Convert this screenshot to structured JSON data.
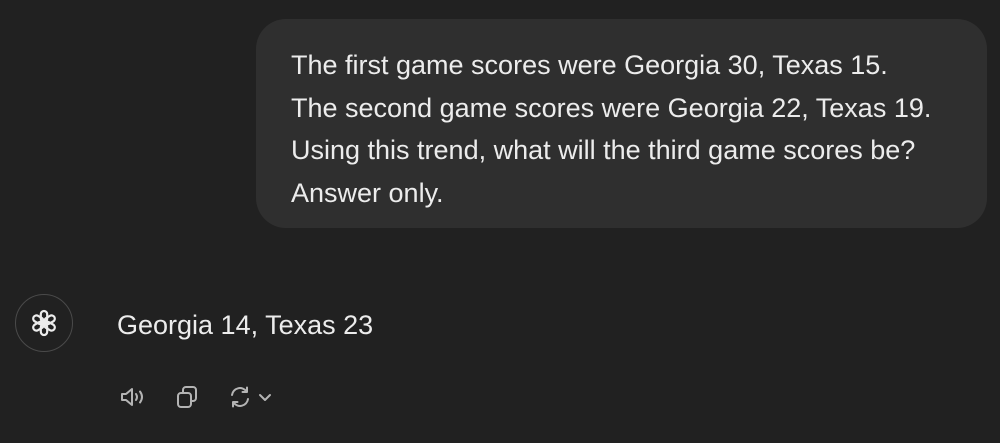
{
  "user_message": {
    "lines": [
      "The first game scores were Georgia 30, Texas 15.",
      "The second game scores were Georgia 22, Texas 19.",
      "Using this trend, what will the third game scores be?",
      "Answer only."
    ]
  },
  "assistant_message": {
    "avatar_icon": "openai-logo-icon",
    "text": "Georgia 14, Texas 23"
  },
  "actions": {
    "items": [
      "read-aloud-icon",
      "copy-icon",
      "regenerate-icon",
      "chevron-down-icon"
    ]
  },
  "colors": {
    "background": "#212121",
    "bubble": "#2f2f2f",
    "text": "#ececec",
    "icon": "#b4b4b4"
  }
}
